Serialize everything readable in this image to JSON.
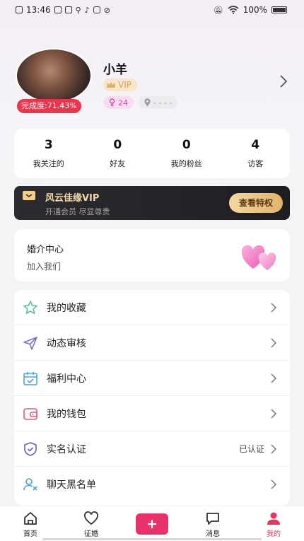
{
  "status_bar": {
    "time": "13:46",
    "battery": "100%"
  },
  "profile": {
    "username": "小羊",
    "completion": "完成度:71.43%",
    "vip_label": "VIP",
    "age": "24",
    "location": "- - - -"
  },
  "stats": [
    {
      "value": "3",
      "label": "我关注的"
    },
    {
      "value": "0",
      "label": "好友"
    },
    {
      "value": "0",
      "label": "我的粉丝"
    },
    {
      "value": "4",
      "label": "访客"
    }
  ],
  "vip_banner": {
    "title": "风云佳缘VIP",
    "subtitle": "开通会员 尽显尊贵",
    "button": "查看特权"
  },
  "matchmaking": {
    "title": "婚介中心",
    "subtitle": "加入我们"
  },
  "menu": [
    {
      "label": "我的收藏",
      "icon": "star-icon",
      "value": ""
    },
    {
      "label": "动态审核",
      "icon": "send-icon",
      "value": ""
    },
    {
      "label": "福利中心",
      "icon": "calendar-icon",
      "value": ""
    },
    {
      "label": "我的钱包",
      "icon": "wallet-icon",
      "value": ""
    },
    {
      "label": "实名认证",
      "icon": "shield-check-icon",
      "value": "已认证"
    },
    {
      "label": "聊天黑名单",
      "icon": "user-block-icon",
      "value": ""
    }
  ],
  "tabs": [
    {
      "label": "首页",
      "icon": "home-icon",
      "active": false
    },
    {
      "label": "征婚",
      "icon": "heart-icon",
      "active": false
    },
    {
      "label": "",
      "icon": "plus-icon",
      "active": false
    },
    {
      "label": "消息",
      "icon": "chat-icon",
      "active": false
    },
    {
      "label": "我的",
      "icon": "person-icon",
      "active": true
    }
  ],
  "colors": {
    "accent": "#e8336a",
    "completion_badge": "#e6374f",
    "vip_gold": "#f2d7a8"
  }
}
